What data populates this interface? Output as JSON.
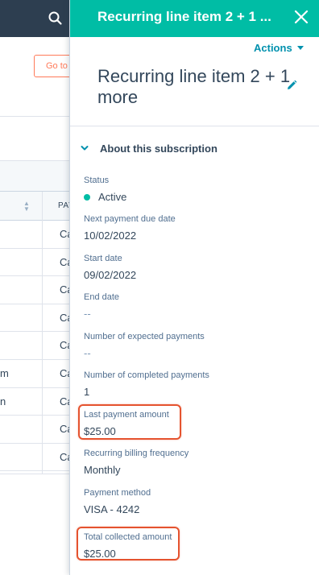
{
  "background": {
    "goto_button_label": "Go to",
    "column_header": "PAY",
    "row_cells": [
      "Ca",
      "Ca",
      "Ca",
      "Ca",
      "Ca",
      "Ca",
      "Ca",
      "Ca",
      "Ca"
    ],
    "row_left_fragments": [
      "",
      "",
      "",
      "",
      "",
      "m",
      "n",
      "",
      ""
    ]
  },
  "panel": {
    "title": "Recurring line item 2 + 1 ...",
    "actions_label": "Actions",
    "record_name": "Recurring line item 2 + 1 more",
    "section_title": "About this subscription",
    "properties": {
      "status": {
        "label": "Status",
        "value": "Active"
      },
      "next_payment": {
        "label": "Next payment due date",
        "value": "10/02/2022"
      },
      "start_date": {
        "label": "Start date",
        "value": "09/02/2022"
      },
      "end_date": {
        "label": "End date",
        "value": "--"
      },
      "expected_payments": {
        "label": "Number of expected payments",
        "value": "--"
      },
      "completed_payments": {
        "label": "Number of completed payments",
        "value": "1"
      },
      "last_payment": {
        "label": "Last payment amount",
        "value": "$25.00"
      },
      "billing_frequency": {
        "label": "Recurring billing frequency",
        "value": "Monthly"
      },
      "payment_method": {
        "label": "Payment method",
        "value": "VISA - 4242"
      },
      "total_collected": {
        "label": "Total collected amount",
        "value": "$25.00"
      }
    }
  },
  "colors": {
    "header": "#00bda5",
    "topbar": "#2d3e50",
    "link": "#0091ae",
    "highlight": "#e5532f",
    "status_active": "#00bda5"
  },
  "icons": [
    "search-icon",
    "close-icon",
    "caret-down-icon",
    "pencil-icon",
    "chevron-down-icon",
    "sort-icon"
  ]
}
